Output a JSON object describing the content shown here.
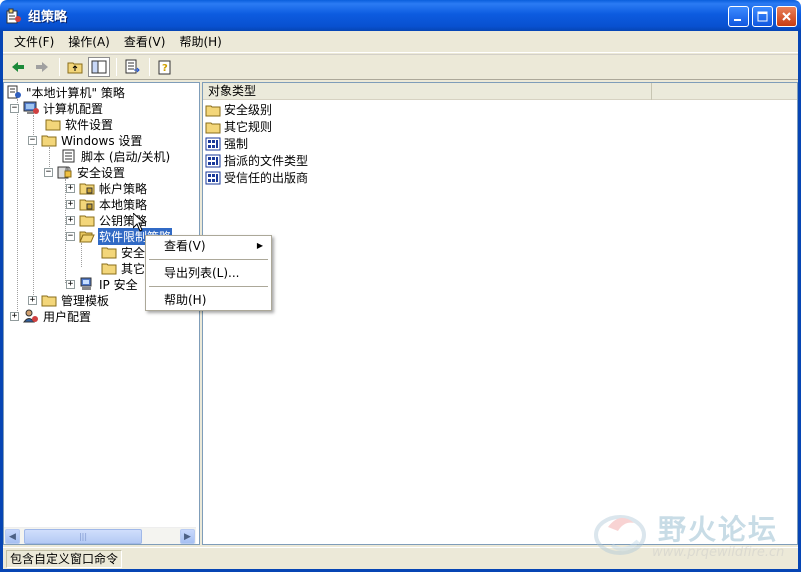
{
  "window": {
    "title": "组策略"
  },
  "menubar": {
    "items": [
      "文件(F)",
      "操作(A)",
      "查看(V)",
      "帮助(H)"
    ]
  },
  "toolbar": {
    "buttons": [
      "back-icon",
      "forward-icon",
      "up-folder-icon",
      "show-hide-tree-icon",
      "export-list-icon",
      "help-icon"
    ]
  },
  "tree": {
    "root": "\"本地计算机\" 策略",
    "computer_config": "计算机配置",
    "software_settings": "软件设置",
    "windows_settings": "Windows 设置",
    "scripts": "脚本 (启动/关机)",
    "security_settings": "安全设置",
    "account_policies": "帐户策略",
    "local_policies": "本地策略",
    "public_key_policies": "公钥策略",
    "software_restriction": "软件限制策略",
    "sub_security_levels": "安全",
    "sub_other_rules": "其它",
    "ip_security": "IP 安全",
    "admin_templates": "管理模板",
    "user_config": "用户配置"
  },
  "list": {
    "column_header": "对象类型",
    "items": [
      {
        "label": "安全级别",
        "icon": "folder-icon"
      },
      {
        "label": "其它规则",
        "icon": "folder-icon"
      },
      {
        "label": "强制",
        "icon": "policy-icon"
      },
      {
        "label": "指派的文件类型",
        "icon": "policy-icon"
      },
      {
        "label": "受信任的出版商",
        "icon": "policy-icon"
      }
    ]
  },
  "context_menu": {
    "view": "查看(V)",
    "export": "导出列表(L)...",
    "help": "帮助(H)"
  },
  "statusbar": {
    "text": "包含自定义窗口命令"
  },
  "watermark": {
    "title": "野火论坛",
    "url": "www.prqewildfire.cn"
  },
  "colors": {
    "titlebar": "#0850d0",
    "selection": "#316ac5",
    "window_bg": "#ece9d8"
  }
}
